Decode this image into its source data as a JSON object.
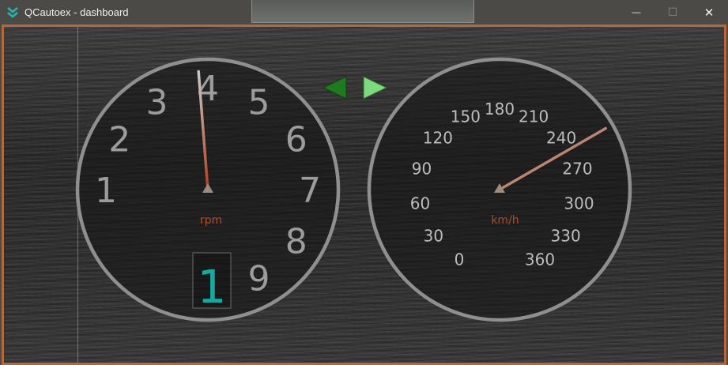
{
  "window": {
    "title": "QCautoex - dashboard",
    "controls": {
      "minimize_glyph": "—",
      "maximize_glyph": "☐",
      "close_glyph": "✕"
    }
  },
  "colors": {
    "frame_border": "#b5683a",
    "unit_label": "#b24a22",
    "gear_text": "#18a8a0",
    "arrow_left": "#1f7a1f",
    "arrow_right": "#7fd97f"
  },
  "tachometer": {
    "unit": "rpm",
    "labels": [
      "1",
      "2",
      "3",
      "4",
      "5",
      "6",
      "7",
      "8",
      "9"
    ],
    "needle_value": 3.85,
    "gear": "1"
  },
  "speedometer": {
    "unit": "km/h",
    "labels": [
      "0",
      "30",
      "60",
      "90",
      "120",
      "150",
      "180",
      "210",
      "240",
      "270",
      "300",
      "330",
      "360"
    ],
    "needle_value": 252
  },
  "nav": {
    "left_arrow_icon": "triangle-left-icon",
    "right_arrow_icon": "triangle-right-icon"
  }
}
